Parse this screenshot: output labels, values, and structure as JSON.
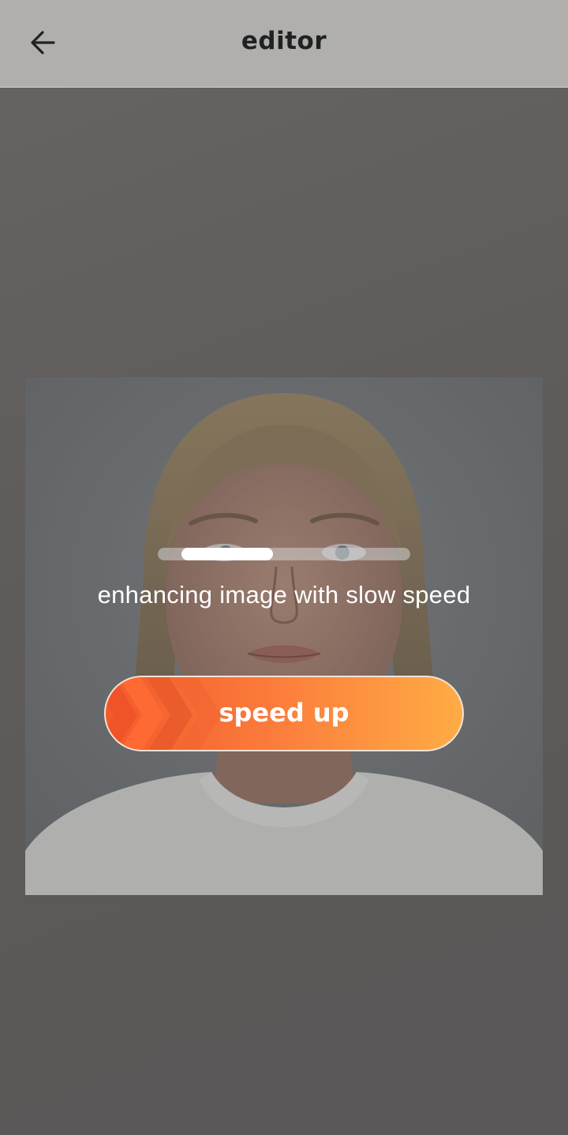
{
  "header": {
    "title": "editor",
    "back_icon": "arrow-left-icon"
  },
  "editor": {
    "progress_fraction": 0.36,
    "status_text": "enhancing image with slow speed",
    "speed_up_label": "speed up",
    "speed_icon": "chevrons-right-icon"
  },
  "colors": {
    "header_bg": "#b0afac",
    "button_gradient_start": "#f25a2a",
    "button_gradient_end": "#ffac45",
    "text_dark": "#1f2223"
  }
}
